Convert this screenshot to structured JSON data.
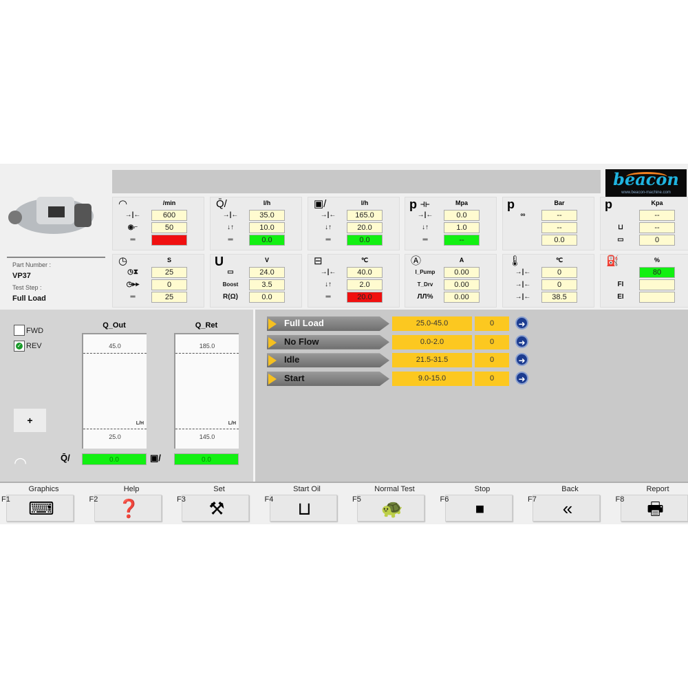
{
  "part": {
    "part_number_label": "Part Number :",
    "part_number": "VP37",
    "test_step_label": "Test Step :",
    "test_step": "Full Load"
  },
  "logo": {
    "brand": "beacon",
    "url_text": "www.beacon-machine.com"
  },
  "panels": [
    {
      "unit": "/min",
      "top_icon": "tachometer-icon",
      "rows": [
        {
          "icon": "setpoint-icon",
          "value": "600",
          "status": "normal"
        },
        {
          "icon": "cam-icon",
          "value": "50",
          "status": "normal"
        },
        {
          "icon": "equals-icon",
          "value": "",
          "status": "red"
        }
      ]
    },
    {
      "unit": "l/h",
      "top_icon": "delivery-flow-icon",
      "rows": [
        {
          "icon": "setpoint-icon",
          "value": "35.0",
          "status": "normal"
        },
        {
          "icon": "tolerance-icon",
          "value": "10.0",
          "status": "normal"
        },
        {
          "icon": "equals-icon",
          "value": "0.0",
          "status": "green"
        }
      ]
    },
    {
      "unit": "l/h",
      "top_icon": "return-flow-icon",
      "rows": [
        {
          "icon": "setpoint-icon",
          "value": "165.0",
          "status": "normal"
        },
        {
          "icon": "tolerance-icon",
          "value": "20.0",
          "status": "normal"
        },
        {
          "icon": "equals-icon",
          "value": "0.0",
          "status": "green"
        }
      ]
    },
    {
      "unit": "Mpa",
      "top_label": "p",
      "top_icon": "pressure-pipe-icon",
      "rows": [
        {
          "icon": "setpoint-icon",
          "value": "0.0",
          "status": "normal"
        },
        {
          "icon": "tolerance-icon",
          "value": "1.0",
          "status": "normal"
        },
        {
          "icon": "equals-icon",
          "value": "--",
          "status": "green"
        }
      ]
    },
    {
      "unit": "Bar",
      "top_label": "p",
      "top_icon": "",
      "rows": [
        {
          "icon": "valve-icon",
          "value": "--",
          "status": "normal"
        },
        {
          "icon": "",
          "value": "--",
          "status": "normal"
        },
        {
          "icon": "",
          "value": "0.0",
          "status": "normal"
        }
      ]
    },
    {
      "unit": "Kpa",
      "top_label": "p",
      "top_icon": "",
      "rows": [
        {
          "icon": "",
          "value": "--",
          "status": "normal"
        },
        {
          "icon": "inlet-icon",
          "value": "--",
          "status": "normal"
        },
        {
          "icon": "tank-icon",
          "value": "0",
          "status": "normal"
        }
      ]
    },
    {
      "unit": "S",
      "top_icon": "clock-icon",
      "rows": [
        {
          "icon": "timer-icon",
          "value": "25",
          "status": "normal"
        },
        {
          "icon": "clock-forward-icon",
          "value": "0",
          "status": "normal"
        },
        {
          "icon": "equals-icon",
          "value": "25",
          "status": "normal"
        }
      ]
    },
    {
      "unit": "V",
      "top_label": "U",
      "top_icon": "",
      "rows": [
        {
          "icon": "battery-icon",
          "value": "24.0",
          "status": "normal"
        },
        {
          "label": "Boost",
          "value": "3.5",
          "status": "normal"
        },
        {
          "label": "R(Ω)",
          "value": "0.0",
          "status": "normal"
        }
      ]
    },
    {
      "unit": "℃",
      "top_icon": "oil-heater-icon",
      "rows": [
        {
          "icon": "setpoint-icon",
          "value": "40.0",
          "status": "normal"
        },
        {
          "icon": "tolerance-icon",
          "value": "2.0",
          "status": "normal"
        },
        {
          "icon": "equals-icon",
          "value": "20.0",
          "status": "red"
        }
      ]
    },
    {
      "unit": "A",
      "top_icon": "ammeter-icon",
      "rows": [
        {
          "label": "I_Pump",
          "value": "0.00",
          "status": "normal"
        },
        {
          "label": "T_Drv",
          "value": "0.00",
          "status": "normal"
        },
        {
          "label": "ЛЛ%",
          "value": "0.00",
          "status": "normal"
        }
      ]
    },
    {
      "unit": "℃",
      "top_icon": "thermometer-icon",
      "rows": [
        {
          "icon": "sensor-icon",
          "value": "0",
          "status": "normal"
        },
        {
          "icon": "sensor-icon",
          "value": "0",
          "status": "normal"
        },
        {
          "icon": "sensor-icon",
          "value": "38.5",
          "status": "normal"
        }
      ]
    },
    {
      "unit": "%",
      "top_icon": "fuel-pump-icon",
      "rows": [
        {
          "label": "",
          "value": "80",
          "status": "green"
        },
        {
          "label": "FI",
          "value": "",
          "status": "normal"
        },
        {
          "label": "EI",
          "value": "",
          "status": "normal"
        }
      ]
    }
  ],
  "direction": {
    "fwd_label": "FWD",
    "rev_label": "REV",
    "fwd_checked": false,
    "rev_checked": true
  },
  "gauges": [
    {
      "title": "Q_Out",
      "max": "45.0",
      "min": "25.0",
      "unit": "L/H",
      "value": "0.0"
    },
    {
      "title": "Q_Ret",
      "max": "185.0",
      "min": "145.0",
      "unit": "L/H",
      "value": "0.0"
    }
  ],
  "plus_label": "+",
  "steps": [
    {
      "name": "Full Load",
      "range": "25.0-45.0",
      "count": "0",
      "active": true
    },
    {
      "name": "No Flow",
      "range": "0.0-2.0",
      "count": "0",
      "active": false
    },
    {
      "name": "Idle",
      "range": "21.5-31.5",
      "count": "0",
      "active": false
    },
    {
      "name": "Start",
      "range": "9.0-15.0",
      "count": "0",
      "active": false
    }
  ],
  "fkeys": [
    {
      "key": "F1",
      "name": "Graphics",
      "icon": "keyboard-icon"
    },
    {
      "key": "F2",
      "name": "Help",
      "icon": "help-icon"
    },
    {
      "key": "F3",
      "name": "Set",
      "icon": "tools-icon"
    },
    {
      "key": "F4",
      "name": "Start Oil",
      "icon": "measuring-cup-icon"
    },
    {
      "key": "F5",
      "name": "Normal Test",
      "icon": "turtle-icon"
    },
    {
      "key": "F6",
      "name": "Stop",
      "icon": "stop-icon"
    },
    {
      "key": "F7",
      "name": "Back",
      "icon": "back-icon"
    },
    {
      "key": "F8",
      "name": "Report",
      "icon": "printer-icon"
    }
  ],
  "colors": {
    "ok": "#12f012",
    "fail": "#f01010",
    "field": "#fffbd0",
    "step_value": "#fcc820",
    "go_button": "#1c3c90"
  }
}
